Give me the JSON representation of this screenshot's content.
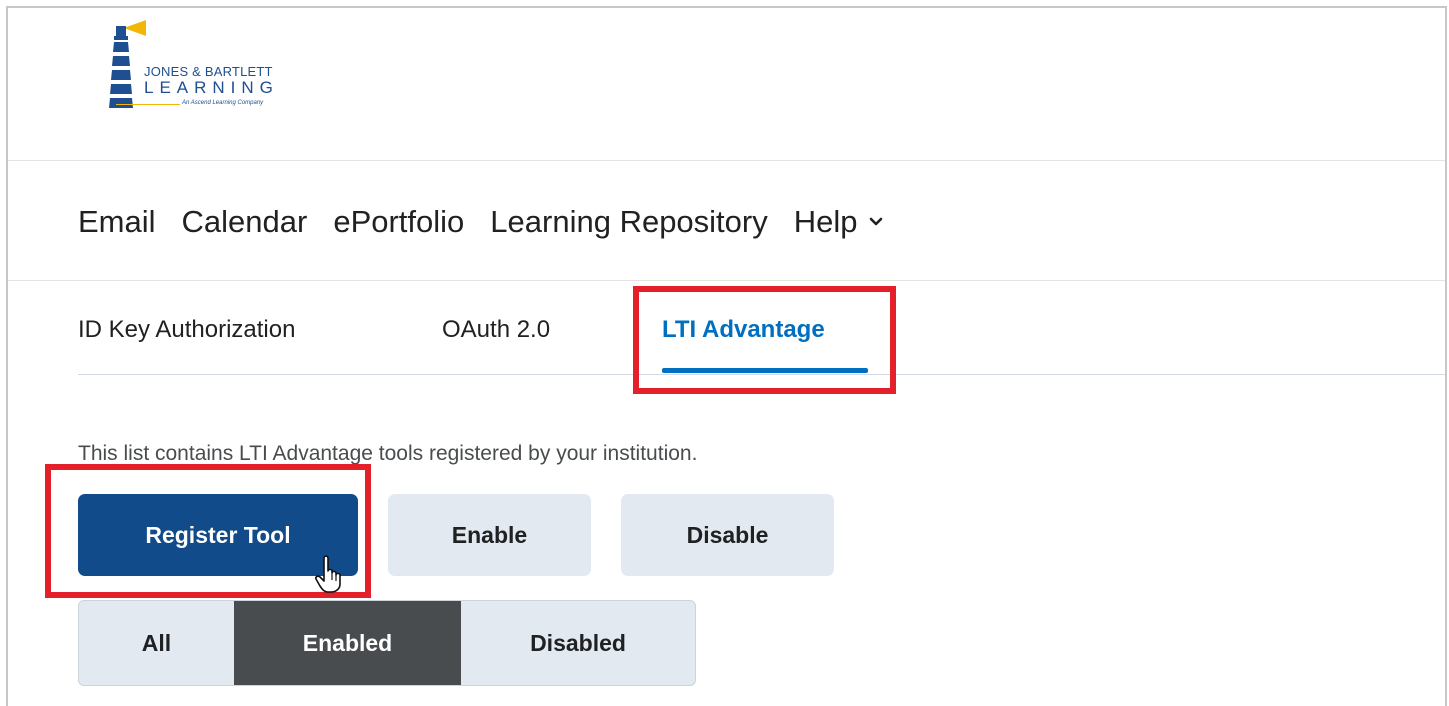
{
  "logo": {
    "line1": "JONES & BARTLETT",
    "line2": "LEARNING",
    "tagline": "An Ascend Learning Company",
    "brand_blue": "#1d4f91",
    "brand_yellow": "#f2b705"
  },
  "nav": {
    "items": [
      {
        "label": "Email"
      },
      {
        "label": "Calendar"
      },
      {
        "label": "ePortfolio"
      },
      {
        "label": "Learning Repository"
      },
      {
        "label": "Help",
        "icon": "chevron-down-icon"
      }
    ]
  },
  "tabs": {
    "items": [
      {
        "label": "ID Key Authorization",
        "active": false
      },
      {
        "label": "OAuth 2.0",
        "active": false
      },
      {
        "label": "LTI Advantage",
        "active": true
      }
    ],
    "active_color": "#006fbf"
  },
  "content": {
    "description": "This list contains LTI Advantage tools registered by your institution.",
    "buttons": {
      "register": "Register Tool",
      "enable": "Enable",
      "disable": "Disable"
    },
    "filter": {
      "options": [
        "All",
        "Enabled",
        "Disabled"
      ],
      "selected": "Enabled"
    }
  },
  "highlight_color": "#e4202a",
  "cursor_icon": "hand-pointer-icon"
}
